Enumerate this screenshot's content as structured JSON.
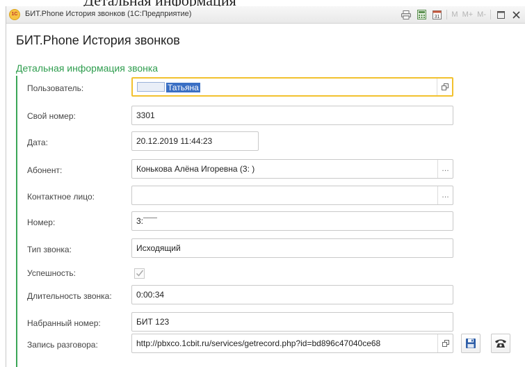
{
  "crop_text": "Детальная информация",
  "window": {
    "app_logo_text": "1С",
    "title": "БИТ.Phone История звонков  (1С:Предприятие)",
    "toolbar": {
      "m": "M",
      "m_plus": "M+",
      "m_minus": "M-"
    }
  },
  "form": {
    "title": "БИТ.Phone История звонков",
    "group_title": "Детальная информация звонка"
  },
  "fields": {
    "user": {
      "label": "Пользователь:",
      "value": "Татьяна"
    },
    "own_number": {
      "label": "Свой номер:",
      "value": "3301"
    },
    "date": {
      "label": "Дата:",
      "value": "20.12.2019 11:44:23"
    },
    "subscriber": {
      "label": "Абонент:",
      "value": "Конькова Алёна Игоревна (3:     )"
    },
    "contact": {
      "label": "Контактное лицо:",
      "value": ""
    },
    "number": {
      "label": "Номер:",
      "value": "3:¯¯¯"
    },
    "call_type": {
      "label": "Тип звонка:",
      "value": "Исходящий"
    },
    "success": {
      "label": "Успешность:",
      "checked": true
    },
    "duration": {
      "label": "Длительность звонка:",
      "value": "0:00:34"
    },
    "dialed": {
      "label": "Набранный номер:",
      "value": "БИТ 123"
    },
    "recording": {
      "label": "Запись разговора:",
      "value": "http://pbxco.1cbit.ru/services/getrecord.php?id=bd896c47040ce68"
    }
  },
  "colors": {
    "group_accent": "#2e9d4e",
    "focus_border": "#f2c12e",
    "selection": "#3a6fc4"
  }
}
